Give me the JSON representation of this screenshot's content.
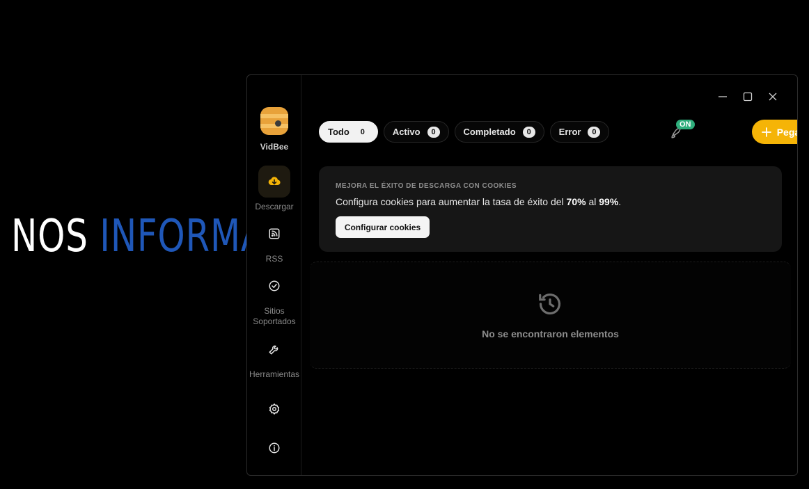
{
  "background": {
    "word1": "NOS",
    "word2": "INFORMAT"
  },
  "app": {
    "name": "VidBee"
  },
  "sidebar": {
    "items": [
      {
        "label": "Descargar"
      },
      {
        "label": "RSS"
      },
      {
        "label": "Sitios Soportados"
      },
      {
        "label": "Herramientas"
      }
    ]
  },
  "tabs": [
    {
      "label": "Todo",
      "count": "0"
    },
    {
      "label": "Activo",
      "count": "0"
    },
    {
      "label": "Completado",
      "count": "0"
    },
    {
      "label": "Error",
      "count": "0"
    }
  ],
  "header": {
    "badge": "ON",
    "paste_label": "Pegar URL"
  },
  "cookies_card": {
    "kicker": "MEJORA EL ÉXITO DE DESCARGA CON COOKIES",
    "msg_prefix": "Configura cookies para aumentar la tasa de éxito del ",
    "from": "70%",
    "msg_mid": " al ",
    "to": "99%",
    "msg_suffix": ".",
    "button": "Configurar cookies"
  },
  "empty": {
    "text": "No se encontraron elementos"
  },
  "colors": {
    "accent": "#f5b407",
    "badge": "#2fae7c",
    "brand_logo": "#e8a23a"
  }
}
